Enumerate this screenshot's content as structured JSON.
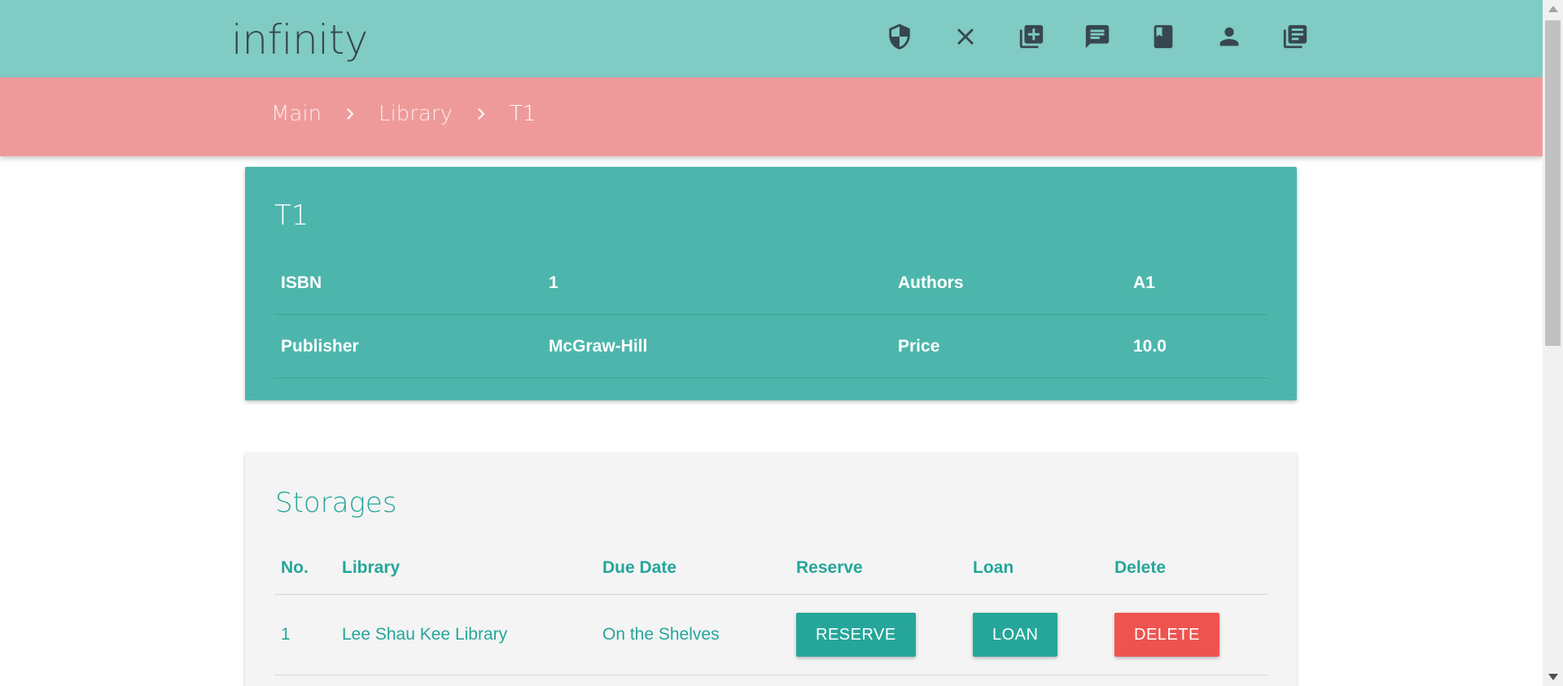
{
  "app": {
    "brand": "infinity"
  },
  "nav_icons": [
    {
      "name": "shield-icon"
    },
    {
      "name": "close-icon"
    },
    {
      "name": "add-library-icon"
    },
    {
      "name": "comment-icon"
    },
    {
      "name": "book-icon"
    },
    {
      "name": "person-icon"
    },
    {
      "name": "library-books-icon"
    }
  ],
  "breadcrumb": {
    "items": [
      "Main",
      "Library",
      "T1"
    ]
  },
  "book": {
    "title": "T1",
    "rows": [
      {
        "label1": "ISBN",
        "value1": "1",
        "label2": "Authors",
        "value2": "A1"
      },
      {
        "label1": "Publisher",
        "value1": "McGraw-Hill",
        "label2": "Price",
        "value2": "10.0"
      }
    ]
  },
  "storages": {
    "title": "Storages",
    "headers": [
      "No.",
      "Library",
      "Due Date",
      "Reserve",
      "Loan",
      "Delete"
    ],
    "rows": [
      {
        "no": "1",
        "library": "Lee Shau Kee Library",
        "due_date": "On the Shelves",
        "reserve_label": "RESERVE",
        "loan_label": "LOAN",
        "delete_label": "DELETE"
      }
    ]
  },
  "colors": {
    "appbar": "#80cbc4",
    "breadcrumb_bar": "#ef9a9a",
    "card": "#4db6ac",
    "accent": "#26a69a",
    "danger": "#ef5350"
  }
}
